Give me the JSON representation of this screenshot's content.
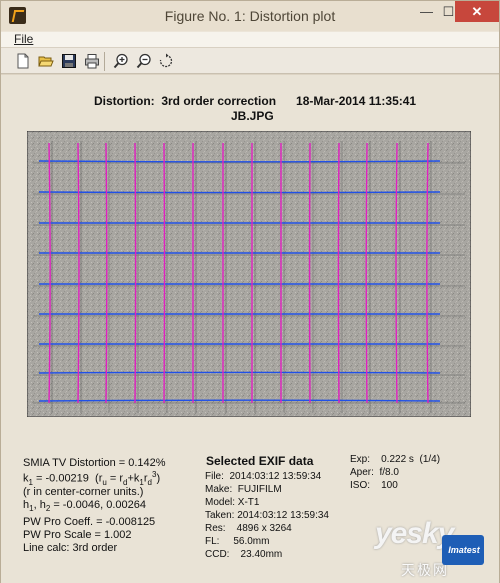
{
  "window": {
    "title": "Figure No. 1: Distortion plot",
    "controls": {
      "minimize": "—",
      "maximize": "☐",
      "close": "✕"
    }
  },
  "menu": {
    "file": "File"
  },
  "toolbar": {
    "items": [
      "new-file-icon",
      "open-folder-icon",
      "save-icon",
      "print-icon",
      "zoom-in-icon",
      "zoom-out-icon",
      "rotate-icon"
    ]
  },
  "plot": {
    "title_line1": "Distortion:  3rd order correction      18-Mar-2014 11:35:41",
    "title_line2": "JB.JPG",
    "grid_vertical_color": "#e020c0",
    "grid_horizontal_color": "#2050e8"
  },
  "stats": {
    "smia": "SMIA TV Distortion = 0.142%",
    "k1": "k",
    "k1_sub": "1",
    "k1_value": " = -0.00219  (r",
    "k1_formula_u": "u",
    "k1_formula_mid": " = r",
    "k1_formula_d": "d",
    "k1_formula_end": "+k",
    "k1_formula_1": "1",
    "k1_formula_r": "r",
    "k1_formula_d2": "d",
    "k1_formula_3": "3",
    "k1_formula_close": ")",
    "note": "(r in center-corner units.)",
    "h": "h",
    "h1": "1",
    "h_comma": ", h",
    "h2": "2",
    "h_values": " = -0.0046, 0.00264",
    "pw_coeff": "PW Pro Coeff. = -0.008125",
    "pw_scale": "PW Pro Scale = 1.002",
    "line_calc": "Line calc: 3rd order"
  },
  "exif": {
    "heading": "Selected EXIF data",
    "file": "File:  2014:03:12 13:59:34",
    "make": "Make:  FUJIFILM",
    "model": "Model: X-T1",
    "taken": "Taken: 2014:03:12 13:59:34",
    "res": "Res:    4896 x 3264",
    "fl": "FL:     56.0mm",
    "ccd": "CCD:    23.40mm"
  },
  "exposure": {
    "exp": "Exp:    0.222 s  (1/4)",
    "aper": "Aper:  f/8.0",
    "iso": "ISO:    100"
  },
  "watermark": {
    "text": "yesky",
    "cn": "天极网",
    "logo": "Imatest"
  }
}
